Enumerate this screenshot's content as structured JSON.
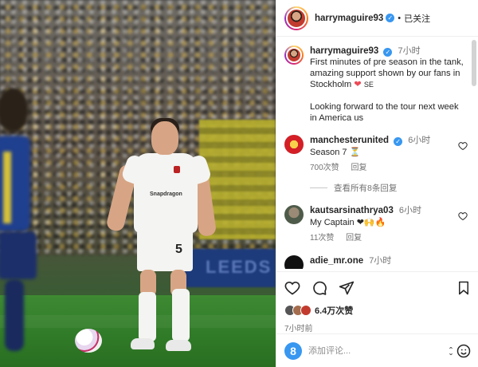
{
  "header": {
    "username": "harrymaguire93",
    "verified_mark": "✓",
    "follow_status": "已关注",
    "separator": "•",
    "more_icon": "more-horizontal-icon"
  },
  "caption": {
    "username": "harrymaguire93",
    "time": "7小时",
    "line1": "First minutes of pre season in the tank, amazing support shown by our fans in Stockholm ",
    "heart": "❤",
    "flag": "SE",
    "line2": "Looking forward to the tour next week in America us"
  },
  "comments": [
    {
      "username": "manchesterunited",
      "verified": true,
      "time": "6小时",
      "text": "Season 7 ⏳",
      "likes": "700次赞",
      "reply": "回复"
    },
    {
      "username": "kautsarsinathrya03",
      "verified": false,
      "time": "6小时",
      "text": "My Captain ❤🙌🔥",
      "likes": "11次赞",
      "reply": "回复"
    },
    {
      "username": "adie_mr.one",
      "verified": false,
      "time": "7小时",
      "text": ""
    }
  ],
  "view_replies": "查看所有8条回复",
  "actions": {
    "like_icon": "heart-outline-icon",
    "comment_icon": "comment-bubble-icon",
    "share_icon": "paper-plane-icon",
    "save_icon": "bookmark-icon"
  },
  "likes_text": "6.4万次赞",
  "timestamp": "7小时前",
  "composer": {
    "placeholder": "添加评论...",
    "app_letter": "8"
  },
  "photo": {
    "shirt_number": "5",
    "sponsor": "Snapdragon",
    "banner": "LEEDS"
  },
  "colors": {
    "verified": "#3897f0",
    "heart": "#ed4956",
    "secondary_text": "#737373"
  }
}
